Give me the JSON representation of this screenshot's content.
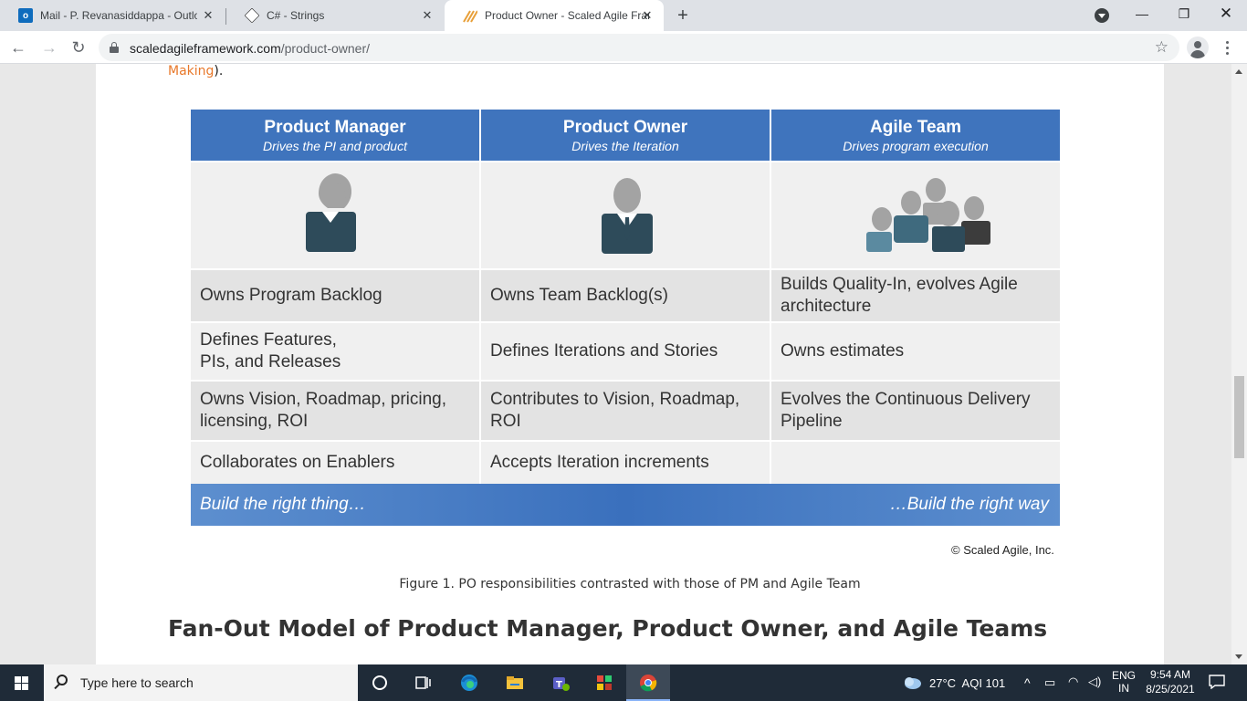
{
  "browser": {
    "tabs": [
      {
        "title": "Mail - P. Revanasiddappa - Outlook",
        "favicon": "outlook-icon",
        "color": "#0f6cbd"
      },
      {
        "title": "C# - Strings",
        "favicon": "diamond-icon",
        "color": "#444444"
      },
      {
        "title": "Product Owner - Scaled Agile Framework",
        "favicon": "safe-icon",
        "color": "#e8a03a"
      }
    ],
    "new_tab": "+",
    "url_host": "scaledagileframework.com",
    "url_path": "/product-owner/"
  },
  "page": {
    "cut_link": "Making",
    "cut_tail": ").",
    "figure": {
      "columns": [
        {
          "title": "Product Manager",
          "subtitle": "Drives the PI and product"
        },
        {
          "title": "Product Owner",
          "subtitle": "Drives the Iteration"
        },
        {
          "title": "Agile Team",
          "subtitle": "Drives program execution"
        }
      ],
      "rows": [
        [
          "Owns Program Backlog",
          "Owns Team Backlog(s)",
          "Builds Quality-In, evolves Agile architecture"
        ],
        [
          "Defines Features,\nPIs, and Releases",
          "Defines Iterations and Stories",
          "Owns estimates"
        ],
        [
          "Owns Vision, Roadmap, pricing, licensing, ROI",
          "Contributes to Vision, Roadmap, ROI",
          "Evolves the Continuous Delivery Pipeline"
        ],
        [
          "Collaborates on Enablers",
          "Accepts Iteration increments",
          ""
        ]
      ],
      "footer_left": "Build the right thing…",
      "footer_right": "…Build the right way",
      "copyright": "© Scaled Agile, Inc.",
      "colors": {
        "header": "#3f74bd",
        "person_dark": "#2e4b5a",
        "person_gray": "#a3a3a3"
      }
    },
    "caption": "Figure 1. PO responsibilities contrasted with those of PM and Agile Team",
    "heading": "Fan-Out Model of Product Manager, Product Owner, and Agile Teams"
  },
  "taskbar": {
    "search_placeholder": "Type here to search",
    "weather": "27°C  AQI 101",
    "lang_top": "ENG",
    "lang_bottom": "IN",
    "time": "9:54 AM",
    "date": "8/25/2021"
  }
}
